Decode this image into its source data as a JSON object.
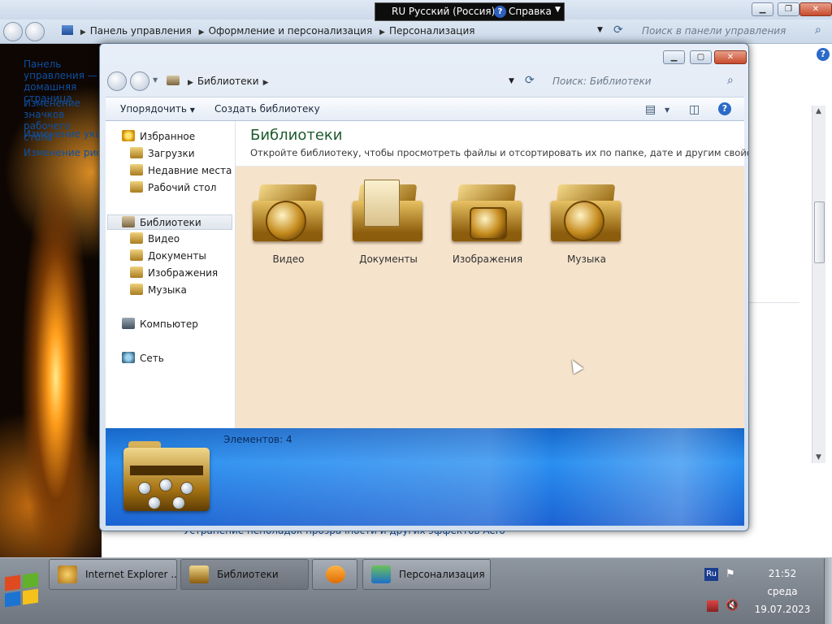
{
  "background_window": {
    "breadcrumb": [
      "Панель управления",
      "Оформление и персонализация",
      "Персонализация"
    ],
    "search_placeholder": "Поиск в панели управления",
    "sidebar_links": [
      "Панель управления — домашняя страница",
      "Изменение значков рабочего стола",
      "Изменение указателей мыши",
      "Изменение рисунка учетной записи"
    ],
    "bottom_link": "Устранение неполадок прозрачности и других эффектов Aero"
  },
  "language_bar": {
    "language": "RU Русский (Россия)",
    "help": "Справка"
  },
  "explorer": {
    "breadcrumb": "Библиотеки",
    "search_placeholder": "Поиск: Библиотеки",
    "toolbar": {
      "organize": "Упорядочить",
      "new_library": "Создать библиотеку"
    },
    "nav": {
      "favorites": "Избранное",
      "downloads": "Загрузки",
      "recent": "Недавние места",
      "desktop": "Рабочий стол",
      "libraries": "Библиотеки",
      "video": "Видео",
      "documents": "Документы",
      "images": "Изображения",
      "music": "Музыка",
      "computer": "Компьютер",
      "network": "Сеть"
    },
    "content": {
      "title": "Библиотеки",
      "subtitle": "Откройте библиотеку, чтобы просмотреть файлы и отсортировать их по папке, дате и другим свойств...",
      "libraries": [
        "Видео",
        "Документы",
        "Изображения",
        "Музыка"
      ]
    },
    "details": {
      "count": "Элементов: 4"
    }
  },
  "taskbar": {
    "buttons": [
      "Internet Explorer ...",
      "Библиотеки",
      "Персонализация"
    ],
    "tray": {
      "lang": "Ru",
      "time": "21:52",
      "day": "среда",
      "date": "19.07.2023"
    }
  },
  "colors": {
    "accent": "#1e5a2d",
    "link": "#0d50a3",
    "content_bg": "#f5e3cc",
    "details_blue": "#2a8ff0"
  },
  "icons": [
    "back-arrow-icon",
    "forward-arrow-icon",
    "search-icon",
    "refresh-icon",
    "help-icon",
    "view-options-icon",
    "preview-pane-icon",
    "star-icon",
    "folder-icon",
    "library-icon",
    "computer-icon",
    "network-icon",
    "windows-logo-icon",
    "media-player-icon",
    "flag-icon",
    "speaker-muted-icon"
  ]
}
